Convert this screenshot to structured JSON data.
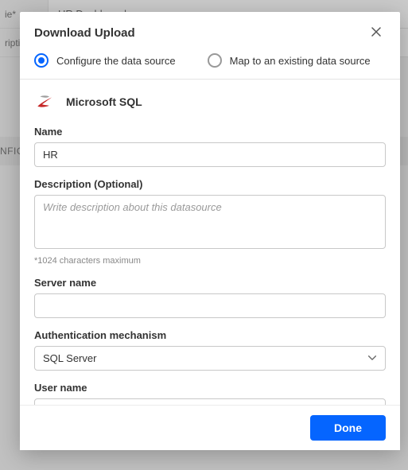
{
  "background": {
    "row1_label": "ie*",
    "row1_value": "HR Dashboard",
    "row2_label": "riptio",
    "config_label": "NFIG"
  },
  "modal": {
    "title": "Download Upload",
    "close_aria": "Close",
    "options": {
      "configure": "Configure the data source",
      "map": "Map to an existing data source",
      "selected": "configure"
    },
    "datasource": {
      "icon": "mssql-icon",
      "name": "Microsoft SQL"
    },
    "fields": {
      "name_label": "Name",
      "name_value": "HR",
      "description_label": "Description (Optional)",
      "description_value": "",
      "description_placeholder": "Write description about this datasource",
      "description_hint": "*1024 characters maximum",
      "server_label": "Server name",
      "server_value": "",
      "auth_label": "Authentication mechanism",
      "auth_value": "SQL Server",
      "user_label": "User name",
      "user_value": ""
    },
    "footer": {
      "done": "Done"
    }
  }
}
